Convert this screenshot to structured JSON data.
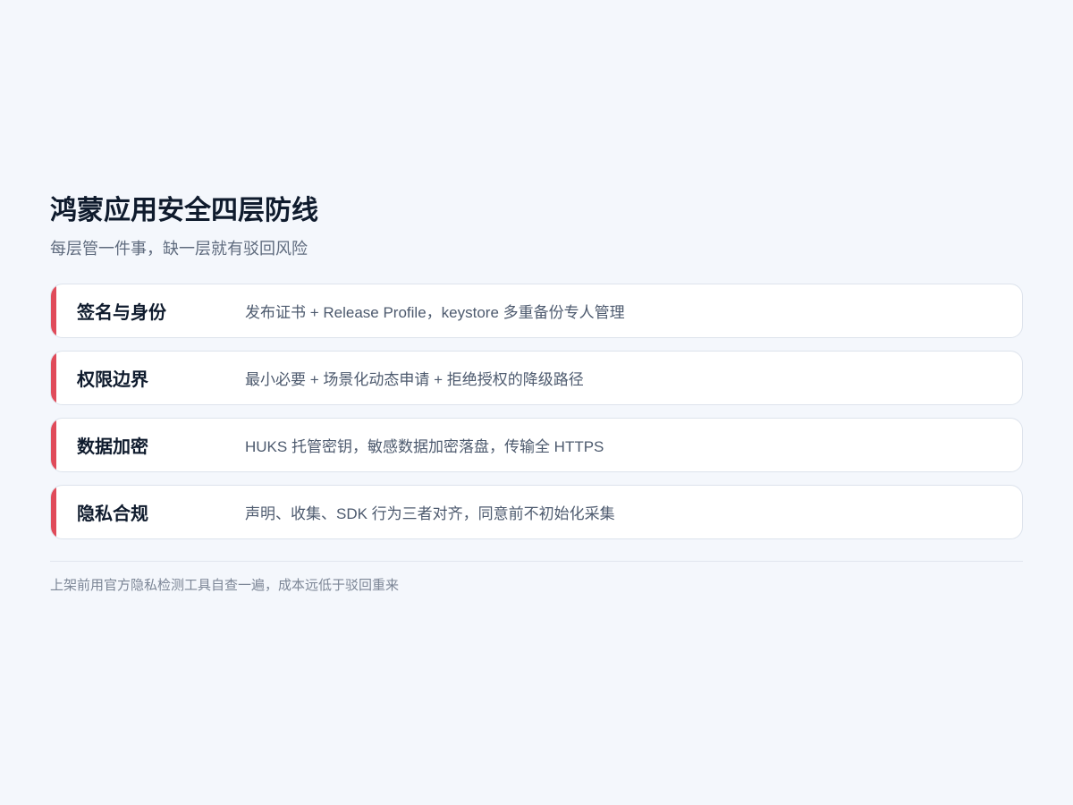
{
  "title": "鸿蒙应用安全四层防线",
  "subtitle": "每层管一件事，缺一层就有驳回风险",
  "cards": [
    {
      "label": "签名与身份",
      "description": "发布证书 + Release Profile，keystore 多重备份专人管理"
    },
    {
      "label": "权限边界",
      "description": "最小必要 + 场景化动态申请 + 拒绝授权的降级路径"
    },
    {
      "label": "数据加密",
      "description": "HUKS 托管密钥，敏感数据加密落盘，传输全 HTTPS"
    },
    {
      "label": "隐私合规",
      "description": "声明、收集、SDK 行为三者对齐，同意前不初始化采集"
    }
  ],
  "footer": "上架前用官方隐私检测工具自查一遍，成本远低于驳回重来",
  "colors": {
    "accent": "#e04b5a",
    "background": "#f4f7fc",
    "title": "#0f1b2d"
  }
}
